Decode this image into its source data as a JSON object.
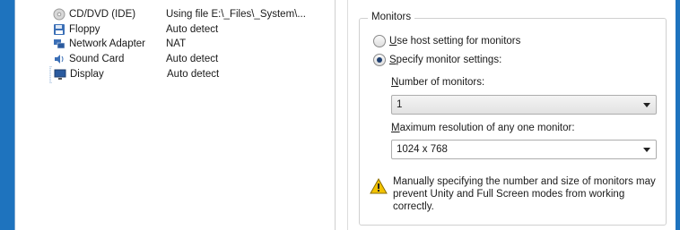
{
  "devices": [
    {
      "name": "CD/DVD (IDE)",
      "value": "Using file E:\\_Files\\_System\\...",
      "icon": "cd-icon"
    },
    {
      "name": "Floppy",
      "value": "Auto detect",
      "icon": "floppy-icon"
    },
    {
      "name": "Network Adapter",
      "value": "NAT",
      "icon": "network-icon"
    },
    {
      "name": "Sound Card",
      "value": "Auto detect",
      "icon": "sound-icon"
    },
    {
      "name": "Display",
      "value": "Auto detect",
      "icon": "display-icon"
    }
  ],
  "monitors": {
    "title": "Monitors",
    "option1_key": "U",
    "option1_rest": "se host setting for monitors",
    "option2_key": "S",
    "option2_rest": "pecify monitor settings:",
    "selected": "specify",
    "num_label_key": "N",
    "num_label_rest": "umber of monitors:",
    "num_value": "1",
    "res_label_key": "M",
    "res_label_rest": "aximum resolution of any one monitor:",
    "res_value": "1024 x 768",
    "warning_text": "Manually specifying the number and size of monitors may prevent Unity and Full Screen modes from working correctly."
  },
  "colors": {
    "frame": "#1e73be",
    "warning": "#f2c200"
  }
}
